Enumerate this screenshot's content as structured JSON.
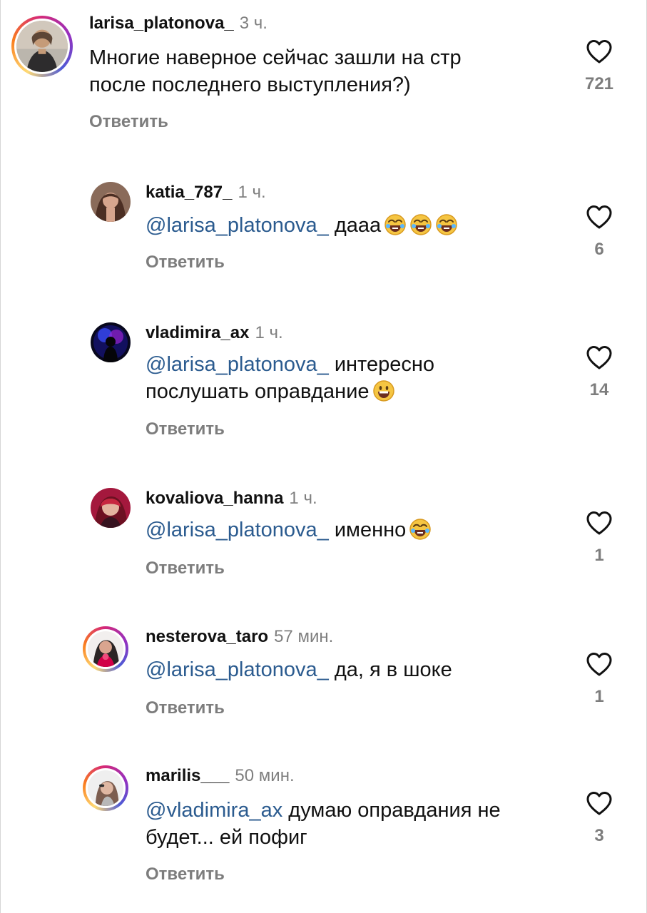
{
  "accent_color": "#2b5b8f",
  "story_ring_colors": [
    "#feda75",
    "#fa7e1e",
    "#d62976",
    "#962fbf",
    "#4f5bd5"
  ],
  "comments": [
    {
      "username": "larisa_platonova_",
      "time": "3 ч.",
      "lines": [
        "Многие наверное сейчас зашли на стр",
        "после последнего выступления?)"
      ],
      "reply_label": "Ответить",
      "likes": "721"
    },
    {
      "username": "katia_787_",
      "time": "1 ч.",
      "mention": "@larisa_platonova_",
      "text": "дааа",
      "emojis": [
        "joy",
        "joy",
        "joy"
      ],
      "reply_label": "Ответить",
      "likes": "6"
    },
    {
      "username": "vladimira_ax",
      "time": "1 ч.",
      "mention": "@larisa_platonova_",
      "text": "интересно",
      "line2": "послушать оправдание",
      "emojis": [
        "grinning"
      ],
      "reply_label": "Ответить",
      "likes": "14"
    },
    {
      "username": "kovaliova_hanna",
      "time": "1 ч.",
      "mention": "@larisa_platonova_",
      "text": "именно",
      "emojis": [
        "joy"
      ],
      "reply_label": "Ответить",
      "likes": "1"
    },
    {
      "username": "nesterova_taro",
      "time": "57 мин.",
      "mention": "@larisa_platonova_",
      "text": "да, я в шоке",
      "reply_label": "Ответить",
      "likes": "1"
    },
    {
      "username": "marilis___",
      "time": "50 мин.",
      "mention": "@vladimira_ax",
      "text": "думаю оправдания не",
      "line2": "будет... ей пофиг",
      "reply_label": "Ответить",
      "likes": "3"
    }
  ]
}
